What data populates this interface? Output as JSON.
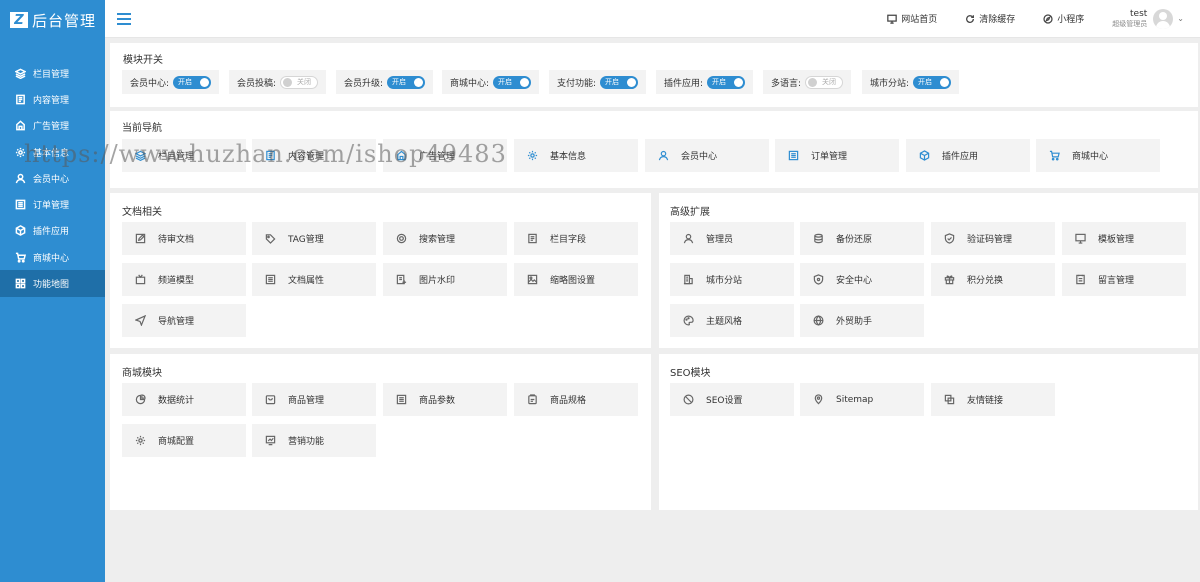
{
  "logo": {
    "mark": "Z",
    "text": "后台管理"
  },
  "sidebar": {
    "items": [
      {
        "label": "栏目管理",
        "icon": "layers-icon"
      },
      {
        "label": "内容管理",
        "icon": "document-icon"
      },
      {
        "label": "广告管理",
        "icon": "ad-icon"
      },
      {
        "label": "基本信息",
        "icon": "gear-icon"
      },
      {
        "label": "会员中心",
        "icon": "user-icon"
      },
      {
        "label": "订单管理",
        "icon": "list-icon"
      },
      {
        "label": "插件应用",
        "icon": "cube-icon"
      },
      {
        "label": "商城中心",
        "icon": "cart-icon"
      },
      {
        "label": "功能地图",
        "icon": "grid-icon"
      }
    ]
  },
  "topbar": {
    "links": [
      {
        "label": "网站首页",
        "icon": "monitor-icon"
      },
      {
        "label": "清除缓存",
        "icon": "refresh-icon"
      },
      {
        "label": "小程序",
        "icon": "compass-icon"
      }
    ],
    "user": {
      "name": "test",
      "role": "超级管理员"
    }
  },
  "modules": {
    "title": "模块开关",
    "switches": [
      {
        "label": "会员中心:",
        "state": "开启",
        "on": true
      },
      {
        "label": "会员投稿:",
        "state": "关闭",
        "on": false
      },
      {
        "label": "会员升级:",
        "state": "开启",
        "on": true
      },
      {
        "label": "商城中心:",
        "state": "开启",
        "on": true
      },
      {
        "label": "支付功能:",
        "state": "开启",
        "on": true
      },
      {
        "label": "插件应用:",
        "state": "开启",
        "on": true
      },
      {
        "label": "多语言:",
        "state": "关闭",
        "on": false
      },
      {
        "label": "城市分站:",
        "state": "开启",
        "on": true
      }
    ]
  },
  "current_nav": {
    "title": "当前导航",
    "items": [
      {
        "label": "栏目管理",
        "icon": "layers-icon"
      },
      {
        "label": "内容管理",
        "icon": "document-icon"
      },
      {
        "label": "广告管理",
        "icon": "ad-icon"
      },
      {
        "label": "基本信息",
        "icon": "gear-icon"
      },
      {
        "label": "会员中心",
        "icon": "user-icon"
      },
      {
        "label": "订单管理",
        "icon": "list-icon"
      },
      {
        "label": "插件应用",
        "icon": "cube-icon"
      },
      {
        "label": "商城中心",
        "icon": "cart-icon"
      }
    ]
  },
  "docs": {
    "title": "文档相关",
    "items": [
      {
        "label": "待审文档",
        "icon": "edit-icon"
      },
      {
        "label": "TAG管理",
        "icon": "tag-icon"
      },
      {
        "label": "搜索管理",
        "icon": "search-icon"
      },
      {
        "label": "栏目字段",
        "icon": "document-icon"
      },
      {
        "label": "频道模型",
        "icon": "tv-icon"
      },
      {
        "label": "文档属性",
        "icon": "list-icon"
      },
      {
        "label": "图片水印",
        "icon": "image-plus-icon"
      },
      {
        "label": "缩略图设置",
        "icon": "image-icon"
      },
      {
        "label": "导航管理",
        "icon": "send-icon"
      }
    ]
  },
  "advanced": {
    "title": "高级扩展",
    "items": [
      {
        "label": "管理员",
        "icon": "user-icon"
      },
      {
        "label": "备份还原",
        "icon": "database-icon"
      },
      {
        "label": "验证码管理",
        "icon": "shield-icon"
      },
      {
        "label": "模板管理",
        "icon": "monitor-icon"
      },
      {
        "label": "城市分站",
        "icon": "building-icon"
      },
      {
        "label": "安全中心",
        "icon": "lock-icon"
      },
      {
        "label": "积分兑换",
        "icon": "gift-icon"
      },
      {
        "label": "留言管理",
        "icon": "message-icon"
      },
      {
        "label": "主题风格",
        "icon": "palette-icon"
      },
      {
        "label": "外贸助手",
        "icon": "globe-icon"
      }
    ]
  },
  "shop": {
    "title": "商城模块",
    "items": [
      {
        "label": "数据统计",
        "icon": "pie-icon"
      },
      {
        "label": "商品管理",
        "icon": "bag-icon"
      },
      {
        "label": "商品参数",
        "icon": "list-icon"
      },
      {
        "label": "商品规格",
        "icon": "clipboard-icon"
      },
      {
        "label": "商城配置",
        "icon": "gear-icon"
      },
      {
        "label": "营销功能",
        "icon": "chart-icon"
      }
    ]
  },
  "seo": {
    "title": "SEO模块",
    "items": [
      {
        "label": "SEO设置",
        "icon": "ban-icon"
      },
      {
        "label": "Sitemap",
        "icon": "map-pin-icon"
      },
      {
        "label": "友情链接",
        "icon": "link-icon"
      }
    ]
  },
  "watermark": "https://www.huzhan.com/ishop49483"
}
